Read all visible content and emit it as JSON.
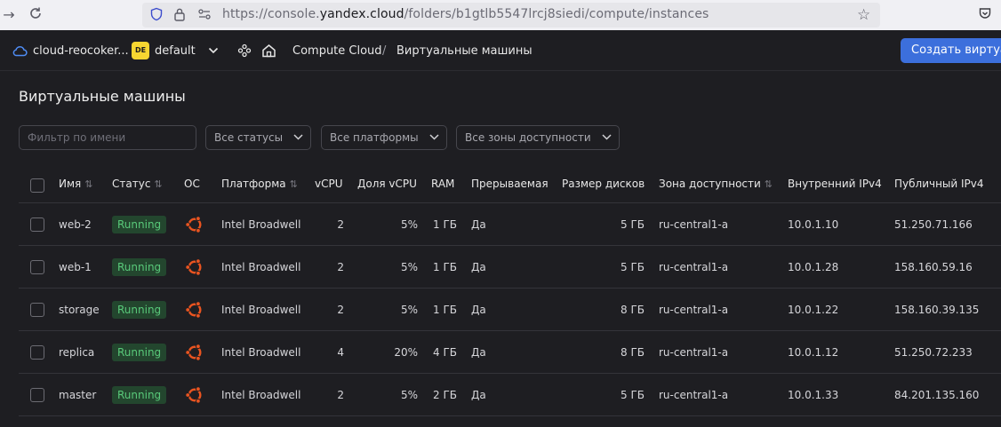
{
  "browser": {
    "url_prefix": "https://console.",
    "url_domain": "yandex.cloud",
    "url_path": "/folders/b1gtlb5547lrcj8siedi/compute/instances"
  },
  "header": {
    "cloud": "cloud-reocoker...",
    "folder_badge": "DE",
    "folder": "default",
    "service": "Compute Cloud",
    "separator": "/",
    "section": "Виртуальные машины",
    "create_button": "Создать виртуальную машину"
  },
  "page": {
    "title": "Виртуальные машины",
    "filter_placeholder": "Фильтр по имени",
    "filters": [
      "Все статусы",
      "Все платформы",
      "Все зоны доступности"
    ]
  },
  "table": {
    "columns": [
      "Имя",
      "Статус",
      "ОС",
      "Платформа",
      "vCPU",
      "Доля vCPU",
      "RAM",
      "Прерываемая",
      "Размер дисков",
      "Зона доступности",
      "Внутренний IPv4",
      "Публичный IPv4"
    ],
    "sort_glyph": "⇅",
    "rows": [
      {
        "name": "web-2",
        "status": "Running",
        "platform": "Intel Broadwell",
        "vcpu": "2",
        "share": "5%",
        "ram": "1 ГБ",
        "preemptible": "Да",
        "disk": "5 ГБ",
        "zone": "ru-central1-a",
        "ip_int": "10.0.1.10",
        "ip_pub": "51.250.71.166"
      },
      {
        "name": "web-1",
        "status": "Running",
        "platform": "Intel Broadwell",
        "vcpu": "2",
        "share": "5%",
        "ram": "1 ГБ",
        "preemptible": "Да",
        "disk": "5 ГБ",
        "zone": "ru-central1-a",
        "ip_int": "10.0.1.28",
        "ip_pub": "158.160.59.16"
      },
      {
        "name": "storage",
        "status": "Running",
        "platform": "Intel Broadwell",
        "vcpu": "2",
        "share": "5%",
        "ram": "1 ГБ",
        "preemptible": "Да",
        "disk": "8 ГБ",
        "zone": "ru-central1-a",
        "ip_int": "10.0.1.22",
        "ip_pub": "158.160.39.135"
      },
      {
        "name": "replica",
        "status": "Running",
        "platform": "Intel Broadwell",
        "vcpu": "4",
        "share": "20%",
        "ram": "4 ГБ",
        "preemptible": "Да",
        "disk": "8 ГБ",
        "zone": "ru-central1-a",
        "ip_int": "10.0.1.12",
        "ip_pub": "51.250.72.233"
      },
      {
        "name": "master",
        "status": "Running",
        "platform": "Intel Broadwell",
        "vcpu": "2",
        "share": "5%",
        "ram": "2 ГБ",
        "preemptible": "Да",
        "disk": "5 ГБ",
        "zone": "ru-central1-a",
        "ip_int": "10.0.1.33",
        "ip_pub": "84.201.135.160"
      }
    ]
  },
  "colors": {
    "status_bg": "#23462e",
    "status_text": "#59c97a",
    "accent": "#3c6fdc",
    "ubuntu": "#e95420"
  }
}
